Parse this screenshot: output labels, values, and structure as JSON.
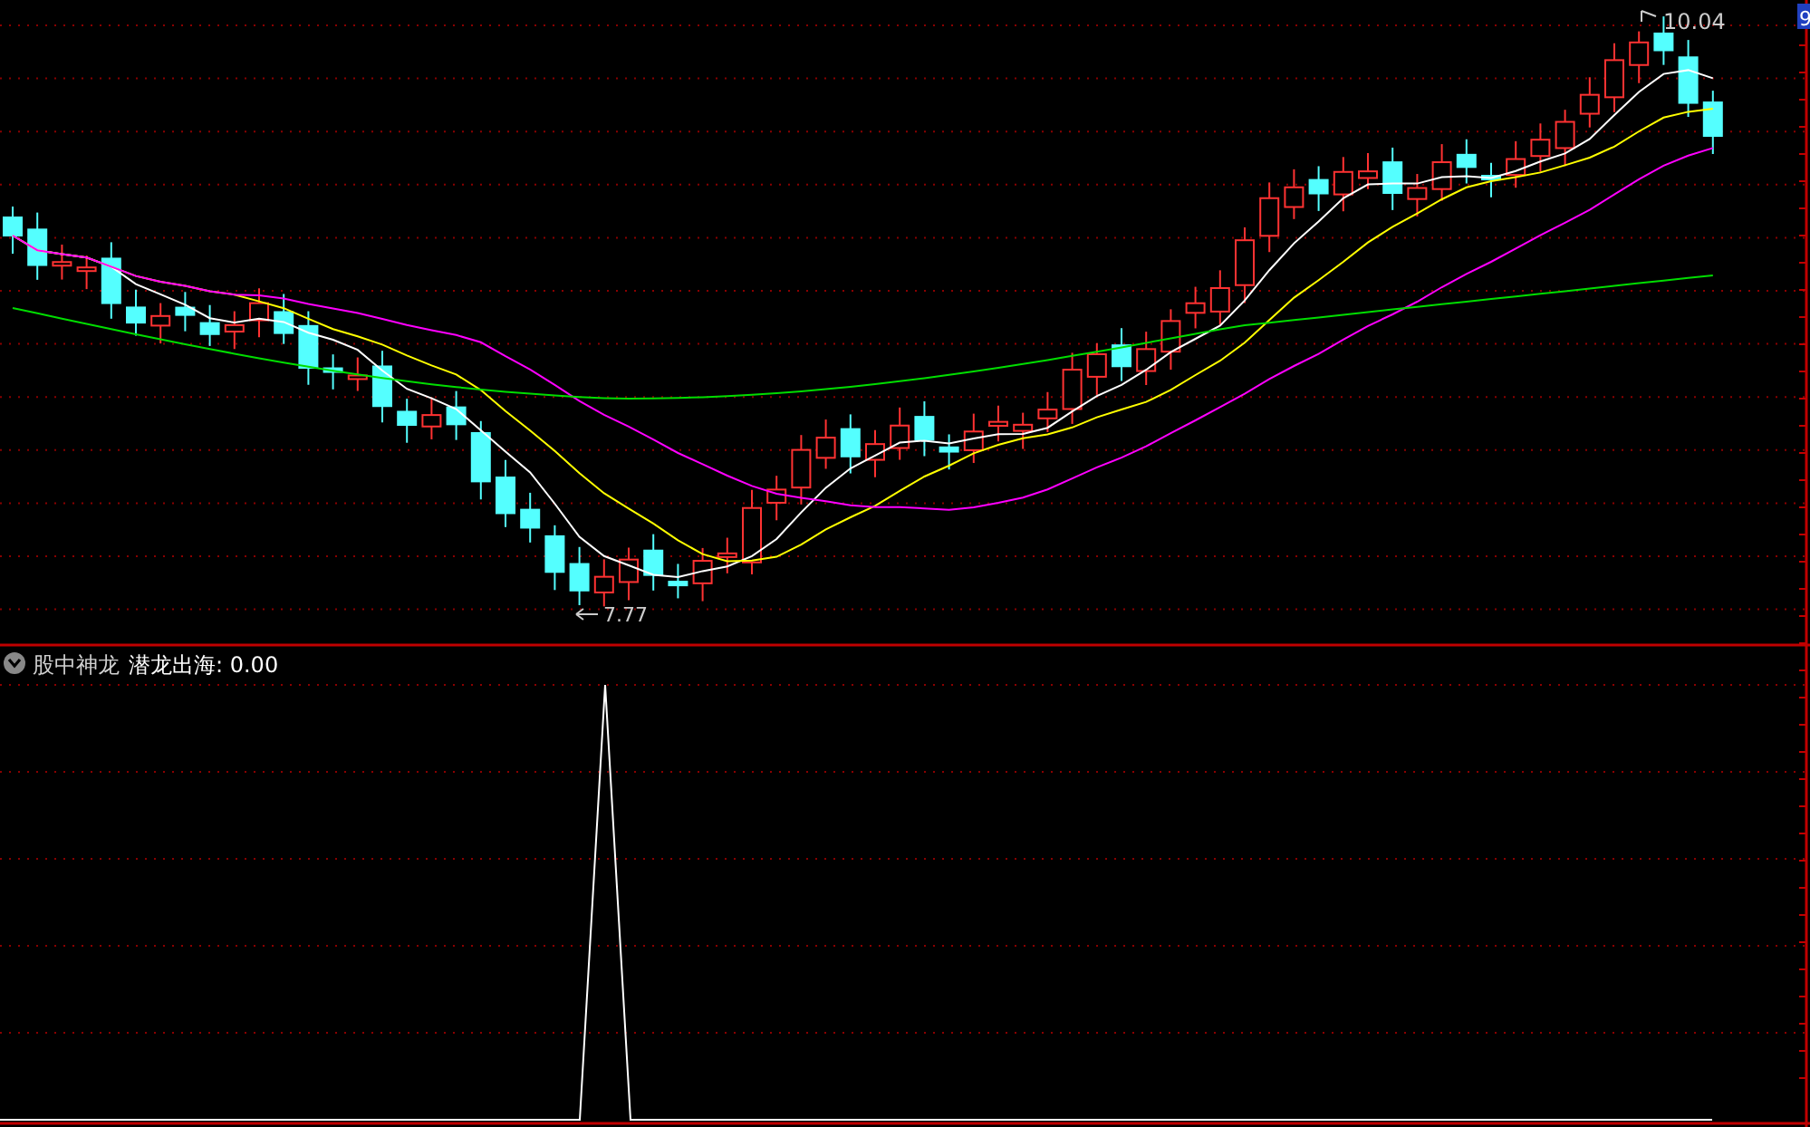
{
  "main_chart": {
    "high_label": "10.04",
    "low_label": "7.77",
    "axis_label": "9"
  },
  "indicator": {
    "name": "股中神龙",
    "signal_label": "潜龙出海: 0.00"
  }
}
